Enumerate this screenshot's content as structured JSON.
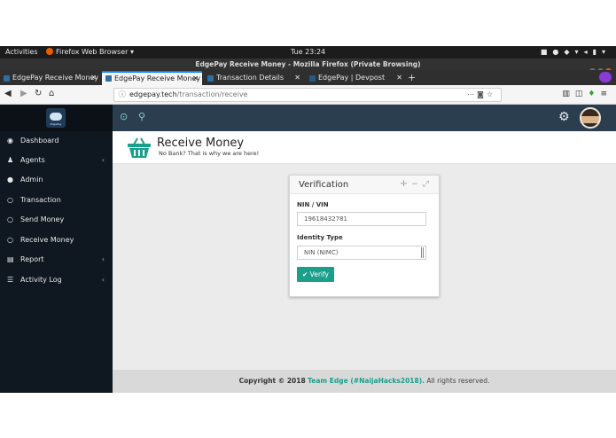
{
  "system_bar": {
    "activities": "Activities",
    "app_menu": "Firefox Web Browser ▾",
    "clock": "Tue 23:24"
  },
  "window": {
    "title": "EdgePay Receive Money - Mozilla Firefox (Private Browsing)"
  },
  "tabs": [
    {
      "label": "EdgePay Receive Money",
      "active": false
    },
    {
      "label": "EdgePay Receive Money",
      "active": true
    },
    {
      "label": "Transaction Details",
      "active": false
    },
    {
      "label": "EdgePay | Devpost",
      "active": false
    }
  ],
  "address_bar": {
    "host": "edgepay.tech",
    "path": "/transaction/receive"
  },
  "sidebar": {
    "logo_text": "EdgePay",
    "items": [
      {
        "label": "Dashboard",
        "icon": "dashboard-icon",
        "has_submenu": false
      },
      {
        "label": "Agents",
        "icon": "users-icon",
        "has_submenu": true
      },
      {
        "label": "Admin",
        "icon": "user-icon",
        "has_submenu": false
      },
      {
        "label": "Transaction",
        "icon": "circle-icon",
        "has_submenu": false
      },
      {
        "label": "Send Money",
        "icon": "circle-icon",
        "has_submenu": false
      },
      {
        "label": "Receive Money",
        "icon": "circle-icon",
        "has_submenu": false
      },
      {
        "label": "Report",
        "icon": "file-icon",
        "has_submenu": true
      },
      {
        "label": "Activity Log",
        "icon": "list-icon",
        "has_submenu": true
      }
    ]
  },
  "page_header": {
    "title": "Receive Money",
    "subtitle": "No Bank? That is why we are here!"
  },
  "verification_panel": {
    "title": "Verification",
    "nin_label": "NIN / VIN",
    "nin_value": "19618432781",
    "identity_label": "Identity Type",
    "identity_selected": "NIN (NIMC)",
    "verify_button": "✔ Verify"
  },
  "footer": {
    "prefix": "Copyright © 2018",
    "team": "Team Edge (#NaijaHacks2018).",
    "suffix": "All rights reserved."
  },
  "colors": {
    "sidebar_bg": "#0f1820",
    "topbar_bg": "#2b3e50",
    "accent": "#1a9f8a",
    "content_bg": "#ebebeb"
  }
}
